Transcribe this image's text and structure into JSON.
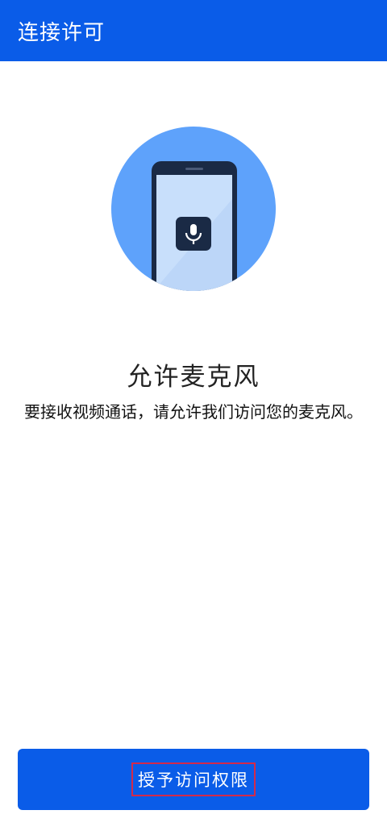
{
  "header": {
    "title": "连接许可"
  },
  "illustration": {
    "icons": [
      "phone-icon",
      "microphone-icon"
    ]
  },
  "permission": {
    "title": "允许麦克风",
    "description": "要接收视频通话，请允许我们访问您的麦克风。"
  },
  "actions": {
    "grant_label": "授予访问权限"
  },
  "colors": {
    "primary": "#0a5ce8",
    "illustration_circle": "#5ea2fb",
    "phone_body": "#1a2a45",
    "phone_screen": "#c8dffb",
    "highlight": "#d42a4a"
  }
}
